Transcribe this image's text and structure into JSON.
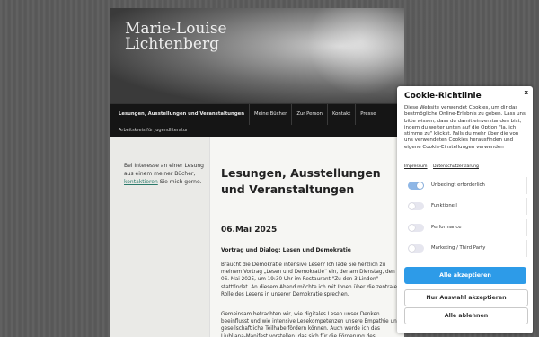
{
  "site": {
    "title_line1": "Marie-Louise",
    "title_line2": "Lichtenberg"
  },
  "nav": {
    "items": [
      {
        "label": "Lesungen, Ausstellungen und Veranstaltungen",
        "active": true
      },
      {
        "label": "Meine Bücher"
      },
      {
        "label": "Zur Person"
      },
      {
        "label": "Kontakt"
      },
      {
        "label": "Presse"
      }
    ],
    "sub_item": "Arbeitskreis für Jugendliteratur"
  },
  "sidebar": {
    "text_before": "Bei Interesse an einer Lesung aus einem meiner Bücher, ",
    "link": "kontaktieren",
    "text_after": " Sie mich gerne."
  },
  "main": {
    "page_title": "Lesungen, Ausstellungen und Veranstaltungen",
    "date": "06.Mai 2025",
    "subheading": "Vortrag und Dialog: Lesen und Demokratie",
    "paragraph1": "Braucht die Demokratie intensive Leser? Ich lade Sie herzlich zu meinem Vortrag „Lesen und Demokratie“ ein, der am Dienstag, den 06. Mai 2025, um 19:30 Uhr im Restaurant \"Zu den 3 Linden\" stattfindet. An diesem Abend möchte ich mit Ihnen über die zentrale Rolle des Lesens in unserer Demokratie sprechen.",
    "paragraph2": "Gemeinsam betrachten wir, wie digitales Lesen unser Denken beeinflusst und wie intensive Lesekompetenzen unsere Empathie und gesellschaftliche Teilhabe fördern können. Auch werde ich das Ljubljana-Manifest vorstellen, das sich für die Förderung des"
  },
  "cookie": {
    "title": "Cookie-Richtlinie",
    "close": "x",
    "description": "Diese Website verwendet Cookies, um dir das bestmögliche Online-Erlebnis zu geben. Lass uns bitte wissen, dass du damit einverstanden bist, indem du weiter unten auf die Option \"Ja, ich stimme zu\" klickst. Falls du mehr über die von uns verwendeten Cookies herausfinden und eigene Cookie-Einstellungen verwenden",
    "link_impressum": "Impressum",
    "link_datenschutz": "Datenschutzerklärung",
    "options": [
      {
        "label": "Unbedingt erforderlich",
        "enabled": true
      },
      {
        "label": "Funktionell",
        "enabled": false
      },
      {
        "label": "Performance",
        "enabled": false
      },
      {
        "label": "Marketing / Third Party",
        "enabled": false
      }
    ],
    "accept_all": "Alle akzeptieren",
    "accept_selection": "Nur Auswahl akzeptieren",
    "reject_all": "Alle ablehnen",
    "accent_color": "#2d9be8"
  }
}
